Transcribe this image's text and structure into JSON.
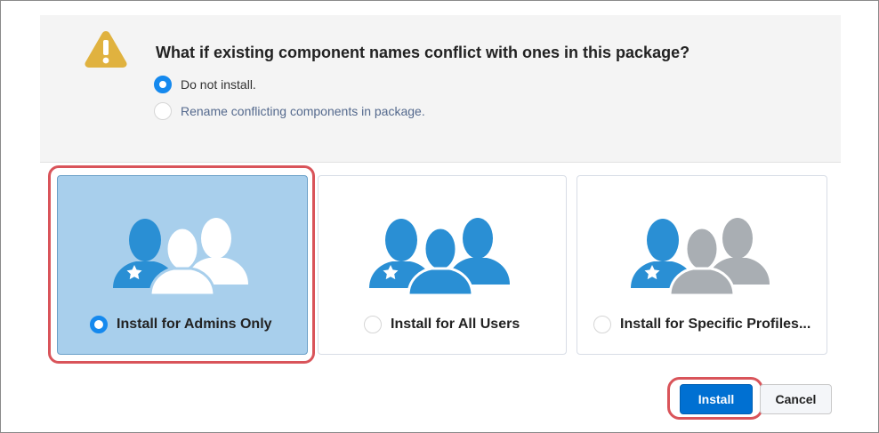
{
  "conflict_panel": {
    "icon": "warning-icon",
    "title": "What if existing component names conflict with ones in this package?",
    "options": [
      {
        "label": "Do not install.",
        "selected": true
      },
      {
        "label": "Rename conflicting components in package.",
        "selected": false
      }
    ]
  },
  "install_options": [
    {
      "label": "Install for Admins Only",
      "icon": "admins-group-icon",
      "selected": true
    },
    {
      "label": "Install for All Users",
      "icon": "all-users-group-icon",
      "selected": false
    },
    {
      "label": "Install for Specific Profiles...",
      "icon": "specific-profiles-group-icon",
      "selected": false
    }
  ],
  "actions": {
    "install_label": "Install",
    "cancel_label": "Cancel"
  },
  "colors": {
    "accent": "#1589ee",
    "primary_button": "#0070d2",
    "selected_card": "#a8cfec",
    "user_blue": "#2a8fd4",
    "user_gray": "#a9aeb3",
    "highlight": "#d9545a",
    "warning": "#e8b53a"
  }
}
